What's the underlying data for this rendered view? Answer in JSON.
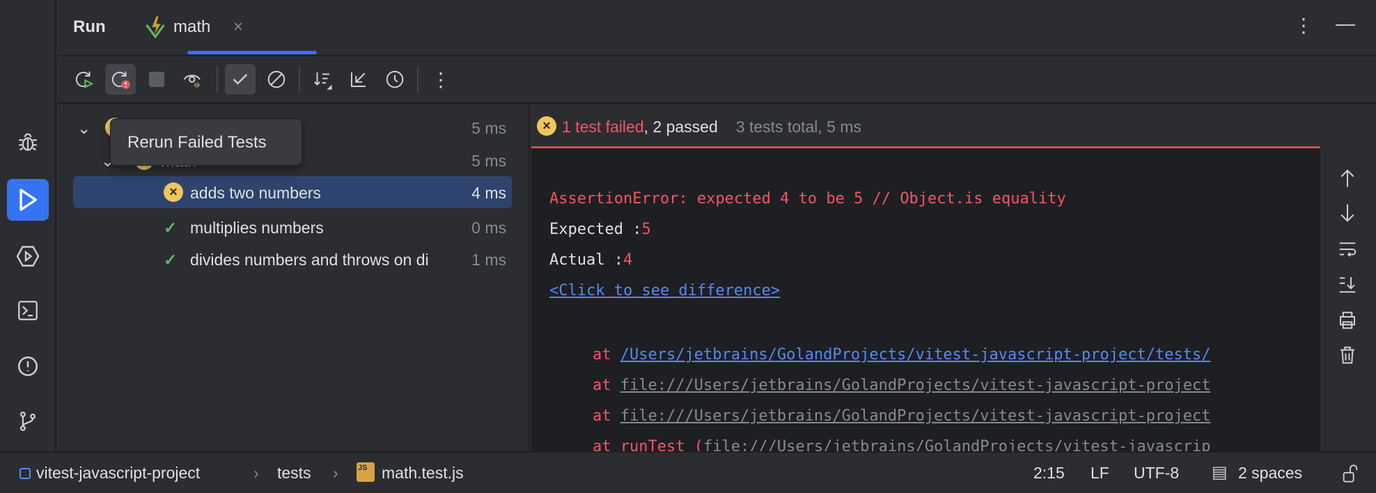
{
  "header": {
    "title": "Run",
    "tab_label": "math"
  },
  "toolbar": {
    "tooltip": "Rerun Failed Tests"
  },
  "tree": {
    "rows": [
      {
        "label": "",
        "time": "5 ms",
        "status": "failed"
      },
      {
        "label": "math",
        "time": "5 ms",
        "status": "failed"
      },
      {
        "label": "adds two numbers",
        "time": "4 ms",
        "status": "failed"
      },
      {
        "label": "multiplies numbers",
        "time": "0 ms",
        "status": "passed"
      },
      {
        "label": "divides numbers and throws on di",
        "time": "1 ms",
        "status": "passed"
      }
    ]
  },
  "summary": {
    "failed": "1 test failed",
    "passed": ", 2 passed",
    "total": "3 tests total, 5 ms"
  },
  "console": {
    "error": "AssertionError: expected 4 to be 5 // Object.is equality",
    "expected_label": "Expected :",
    "expected_value": "5",
    "actual_label": "Actual   :",
    "actual_value": "4",
    "diff_link": "<Click to see difference>",
    "stack": [
      {
        "at": "at ",
        "text": "/Users/jetbrains/GolandProjects/vitest-javascript-project/tests/"
      },
      {
        "at": "at ",
        "text": "file:///Users/jetbrains/GolandProjects/vitest-javascript-project"
      },
      {
        "at": "at ",
        "text": "file:///Users/jetbrains/GolandProjects/vitest-javascript-project"
      },
      {
        "at": "at runTest (",
        "text": "file:///Users/jetbrains/GolandProjects/vitest-javascrip"
      }
    ]
  },
  "status": {
    "project": "vitest-javascript-project",
    "folder": "tests",
    "file": "math.test.js",
    "position": "2:15",
    "line_sep": "LF",
    "encoding": "UTF-8",
    "indent": "2 spaces"
  },
  "colors": {
    "accent": "#3574f0",
    "error": "#f75464",
    "failed_bar": "#c75450",
    "warning": "#f2c55c",
    "pass": "#5fb865"
  }
}
